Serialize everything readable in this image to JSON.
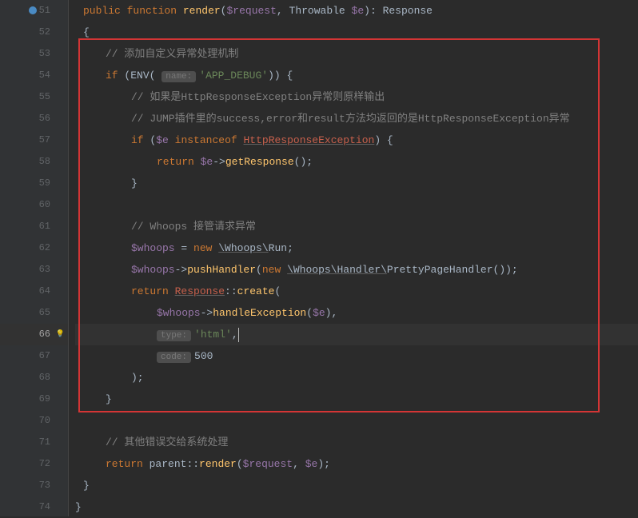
{
  "lines": {
    "start": 51,
    "end": 74,
    "breakpoint_line": 51,
    "lightbulb_line": 66,
    "active_line": 66
  },
  "code": {
    "l51": {
      "kw1": "public",
      "kw2": "function",
      "fn": "render",
      "var1": "$request",
      "cls": "Throwable",
      "var2": "$e",
      "ret": "Response"
    },
    "l52": {
      "brace": "{"
    },
    "l53": {
      "comment": "// 添加自定义异常处理机制"
    },
    "l54": {
      "kw": "if",
      "fn": "ENV",
      "hint": "name:",
      "str": "'APP_DEBUG'",
      "brace": ")) {"
    },
    "l55": {
      "comment": "// 如果是HttpResponseException异常则原样输出"
    },
    "l56": {
      "comment": "// JUMP插件里的success,error和result方法均返回的是HttpResponseException异常"
    },
    "l57": {
      "kw1": "if",
      "var": "$e",
      "kw2": "instanceof",
      "cls": "HttpResponseException",
      "brace": ") {"
    },
    "l58": {
      "kw": "return",
      "var": "$e",
      "arrow": "->",
      "fn": "getResponse",
      "end": "();"
    },
    "l59": {
      "brace": "}"
    },
    "l60": {
      "blank": ""
    },
    "l61": {
      "comment": "// Whoops 接管请求异常"
    },
    "l62": {
      "var": "$whoops",
      "eq": " = ",
      "kw": "new",
      "ns": "\\Whoops\\",
      "cls": "Run",
      "end": ";"
    },
    "l63": {
      "var": "$whoops",
      "arrow": "->",
      "fn": "pushHandler",
      "kw": "new",
      "ns": "\\Whoops\\Handler\\",
      "cls": "PrettyPageHandler",
      "end": "());"
    },
    "l64": {
      "kw": "return",
      "cls": "Response",
      "scope": "::",
      "fn": "create",
      "paren": "("
    },
    "l65": {
      "var1": "$whoops",
      "arrow": "->",
      "fn": "handleException",
      "var2": "$e",
      "end": "),"
    },
    "l66": {
      "hint": "type:",
      "str": "'html'",
      "end": ","
    },
    "l67": {
      "hint": "code:",
      "num": "500"
    },
    "l68": {
      "close": ");"
    },
    "l69": {
      "brace": "}"
    },
    "l70": {
      "blank": ""
    },
    "l71": {
      "comment": "// 其他错误交给系统处理"
    },
    "l72": {
      "kw": "return",
      "obj": "parent",
      "scope": "::",
      "fn": "render",
      "var1": "$request",
      "var2": "$e",
      "end": ");"
    },
    "l73": {
      "brace": "}"
    },
    "l74": {
      "brace": "}"
    }
  }
}
